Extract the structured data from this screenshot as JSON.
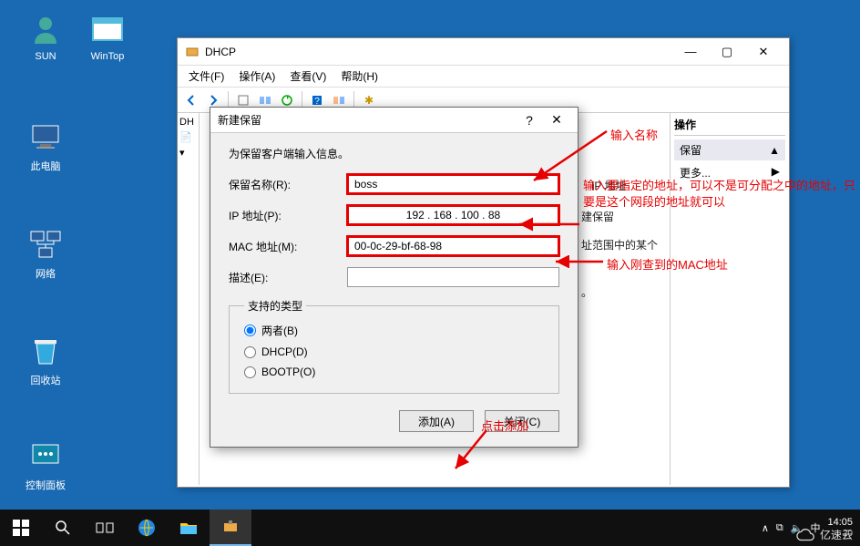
{
  "desktop": {
    "icons": [
      {
        "name": "SUN"
      },
      {
        "name": "WinTop"
      },
      {
        "name": "此电脑"
      },
      {
        "name": "网络"
      },
      {
        "name": "回收站"
      },
      {
        "name": "控制面板"
      }
    ]
  },
  "dhcp": {
    "title": "DHCP",
    "menus": {
      "file": "文件(F)",
      "action": "操作(A)",
      "view": "查看(V)",
      "help": "帮助(H)"
    },
    "tree": {
      "root": "DH",
      "sub1": "▸",
      "sub2": "▾"
    },
    "content": {
      "ip_label": "IP 地址",
      "line1": "建保留",
      "line2": "址范围中的某个",
      "line3": "。"
    },
    "actions": {
      "header": "操作",
      "section": "保留",
      "more": "更多...",
      "caret": "▲",
      "arrow": "▶"
    }
  },
  "dialog": {
    "title": "新建保留",
    "help": "?",
    "close": "✕",
    "intro": "为保留客户端输入信息。",
    "labels": {
      "name": "保留名称(R):",
      "ip": "IP 地址(P):",
      "mac": "MAC 地址(M):",
      "desc": "描述(E):"
    },
    "values": {
      "name": "boss",
      "ip": "192 . 168 . 100 . 88",
      "mac": "00-0c-29-bf-68-98",
      "desc": ""
    },
    "fieldset_title": "支持的类型",
    "radios": {
      "both": "两者(B)",
      "dhcp": "DHCP(D)",
      "bootp": "BOOTP(O)"
    },
    "buttons": {
      "add": "添加(A)",
      "close": "关闭(C)"
    }
  },
  "annotations": {
    "a1": "输入名称",
    "a2": "输入要指定的地址，可以不是可分配之中的地址，只要是这个网段的地址就可以",
    "a3": "输入刚查到的MAC地址",
    "a4": "点击添加"
  },
  "taskbar": {
    "time": "14:05",
    "date_partial": "20",
    "tray": {
      "up": "∧",
      "net": "⧉",
      "vol": "🔈",
      "ime": "中"
    }
  },
  "watermark": "亿速云"
}
